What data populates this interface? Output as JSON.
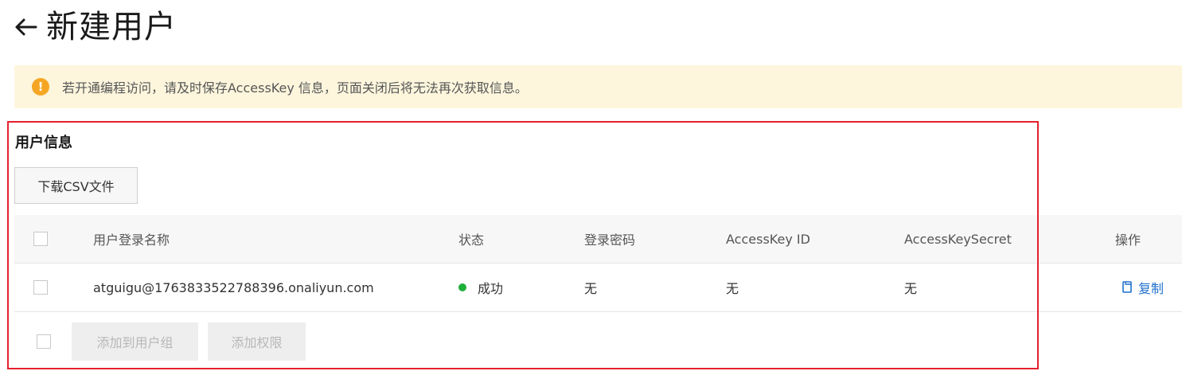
{
  "header": {
    "title": "新建用户",
    "back_icon": "arrow-left-icon"
  },
  "notice": {
    "icon": "exclamation-circle-icon",
    "text": "若开通编程访问，请及时保存AccessKey 信息，页面关闭后将无法再次获取信息。",
    "colors": {
      "background": "#fdf6dd",
      "icon": "#f5a623"
    }
  },
  "section": {
    "title": "用户信息",
    "download_label": "下载CSV文件"
  },
  "table": {
    "columns": [
      "用户登录名称",
      "状态",
      "登录密码",
      "AccessKey ID",
      "AccessKeySecret",
      "操作"
    ],
    "rows": [
      {
        "login_name": "atguigu@1763833522788396.onaliyun.com",
        "status": "成功",
        "password": "无",
        "access_key_id": "无",
        "access_key_secret": "无",
        "action": "复制"
      }
    ],
    "status_color": "#1faf3a",
    "action_color": "#1f6fcc"
  },
  "footer": {
    "add_to_group_label": "添加到用户组",
    "add_permission_label": "添加权限"
  },
  "highlight_color": "#e5202e"
}
